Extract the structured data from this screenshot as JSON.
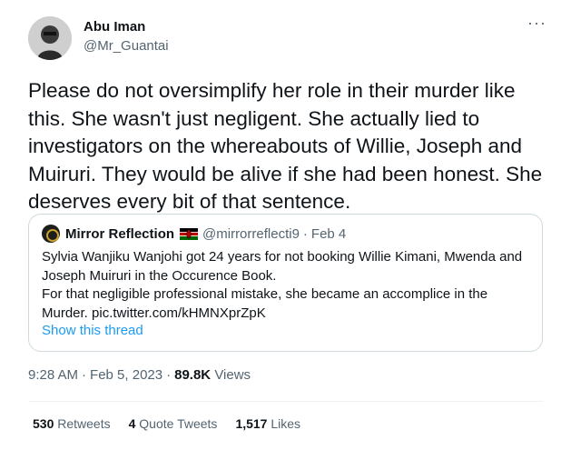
{
  "author": {
    "display_name": "Abu Iman",
    "handle": "@Mr_Guantai"
  },
  "more_menu": "···",
  "tweet": {
    "text": "Please do not oversimplify her role in their murder like this. She wasn't just negligent. She actually lied to investigators on the whereabouts of Willie, Joseph and Muiruri. They would be alive if she had been honest. She deserves every bit of that sentence."
  },
  "quote": {
    "name": "Mirror Reflection",
    "handle": "@mirrorreflecti9",
    "separator": "·",
    "date": "Feb 4",
    "text_line1": "Sylvia Wanjiku Wanjohi got 24 years for not booking Willie Kimani, Mwenda and Joseph Muiruri in the Occurence Book.",
    "text_line2": "For that negligible professional mistake, she became an accomplice in the Murder. pic.twitter.com/kHMNXprZpK",
    "show_thread": "Show this thread"
  },
  "meta": {
    "time": "9:28 AM",
    "separator": "·",
    "date": "Feb 5, 2023",
    "views_count": "89.8K",
    "views_label": "Views"
  },
  "stats": {
    "retweets_count": "530",
    "retweets_label": "Retweets",
    "quotes_count": "4",
    "quotes_label": "Quote Tweets",
    "likes_count": "1,517",
    "likes_label": "Likes"
  },
  "colors": {
    "link": "#1d9bf0",
    "secondary_text": "#536471",
    "primary_text": "#0f1419",
    "border": "#cfd9de"
  }
}
